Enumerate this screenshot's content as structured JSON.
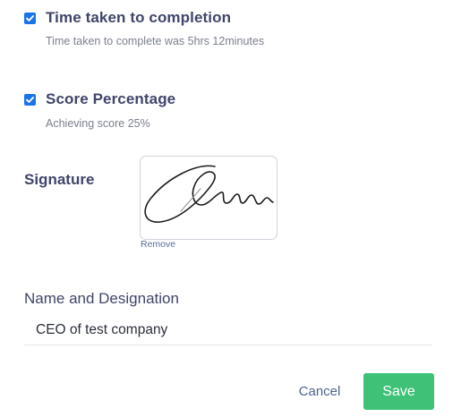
{
  "options": [
    {
      "label": "Time taken to completion",
      "checked": true,
      "helper": "Time taken to complete was 5hrs 12minutes"
    },
    {
      "label": "Score Percentage",
      "checked": true,
      "helper": "Achieving score 25%"
    }
  ],
  "signature": {
    "label": "Signature",
    "remove_label": "Remove"
  },
  "name_designation": {
    "label": "Name and Designation",
    "value": "CEO of test company"
  },
  "actions": {
    "cancel_label": "Cancel",
    "save_label": "Save"
  },
  "colors": {
    "checkbox": "#1a73e8",
    "save_button": "#3fc177",
    "label_text": "#40456a"
  }
}
